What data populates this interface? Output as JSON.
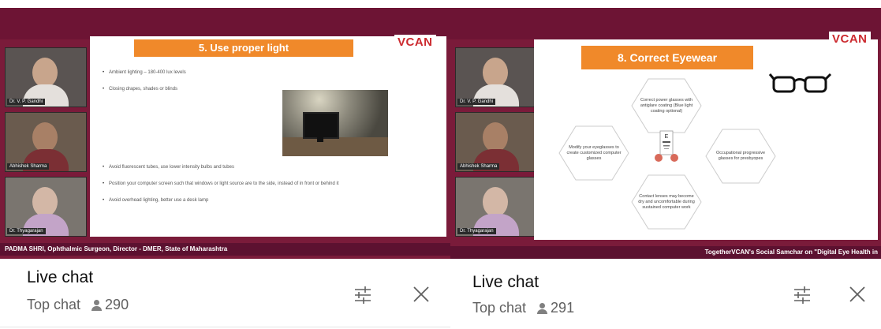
{
  "left": {
    "logo": "VCAN",
    "slide_title": "5. Use proper light",
    "bullets_top": [
      "Ambient lighting – 180-400 lux levels",
      "Closing drapes, shades or blinds"
    ],
    "bullets_bottom": [
      "Avoid fluorescent tubes, use lower intensity bulbs and tubes",
      "Position your computer screen such that windows or light source are to the side, instead of in front or behind it",
      "Avoid overhead lighting, better use a desk lamp"
    ],
    "participants": [
      "Dr. V. P. Gandhi",
      "Abhishek Sharma",
      "Dr. Thyagarajan"
    ],
    "ticker": "PADMA SHRI, Ophthalmic Surgeon, Director - DMER, State of Maharashtra",
    "chat": {
      "title": "Live chat",
      "mode": "Top chat",
      "viewers": "290"
    }
  },
  "right": {
    "logo": "VCAN",
    "slide_title": "8. Correct Eyewear",
    "hexes": [
      "Correct power glasses with antiglare coating (Blue light coating optional)",
      "Modify your eyeglasses to create customized computer glasses",
      "Occupational progressive glasses for presbyopes",
      "Contact lenses may become dry and uncomfortable during sustained computer work"
    ],
    "participants": [
      "Dr. V. P. Gandhi",
      "Abhishek Sharma",
      "Dr. Thyagarajan"
    ],
    "ticker": "TogetherVCAN's Social Samchar on \"Digital Eye Health in",
    "chat": {
      "title": "Live chat",
      "mode": "Top chat",
      "viewers": "291"
    }
  },
  "icons": {
    "viewers": "person-icon",
    "filter": "sliders-icon",
    "close": "close-icon"
  },
  "colors": {
    "video_bg": "#7a1b3a",
    "slide_title_bg": "#f0892a",
    "logo": "#cc2a2f",
    "ticker_bg": "#5c1130"
  }
}
